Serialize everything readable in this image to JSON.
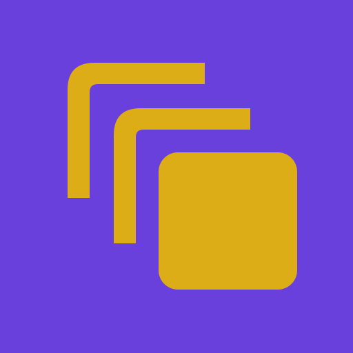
{
  "icon": {
    "name": "stacked-layers-icon",
    "background_color": "#6a40dc",
    "foreground_color": "#dcad16"
  }
}
